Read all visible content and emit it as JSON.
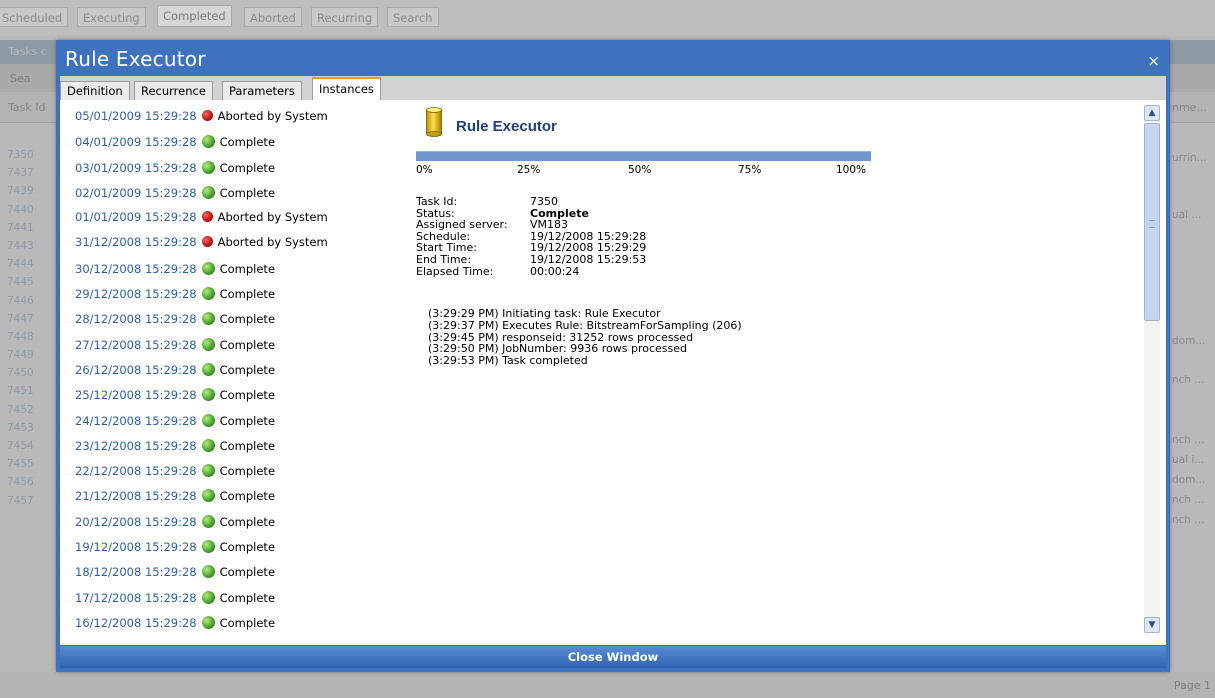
{
  "background": {
    "tabs": [
      "Scheduled",
      "Executing",
      "Completed",
      "Aborted",
      "Recurring",
      "Search"
    ],
    "active_tab": "Completed",
    "strip_label": "Tasks c",
    "search_label": "Sea",
    "column_header": "Task Id",
    "column_header_right": "nme...",
    "task_ids": [
      "7350",
      "7437",
      "7439",
      "7440",
      "7441",
      "7443",
      "7444",
      "7445",
      "7446",
      "7447",
      "7448",
      "7449",
      "7450",
      "7451",
      "7452",
      "7453",
      "7454",
      "7455",
      "7456",
      "7457"
    ],
    "right_fragments": [
      "urrin...",
      "ual ...",
      "dom...",
      "nch ...",
      "nch ...",
      "ual i...",
      "dom...",
      "nch ...",
      "nch ..."
    ],
    "page_label": "Page 1"
  },
  "modal": {
    "title": "Rule Executor",
    "close_label": "×",
    "tabs": [
      "Definition",
      "Recurrence",
      "Parameters",
      "Instances"
    ],
    "active_tab": "Instances",
    "footer_button": "Close Window"
  },
  "instances": [
    {
      "date": "05/01/2009 15:29:28",
      "status": "Aborted by System",
      "color": "red"
    },
    {
      "date": "04/01/2009 15:29:28",
      "status": "Complete",
      "color": "green"
    },
    {
      "date": "03/01/2009 15:29:28",
      "status": "Complete",
      "color": "green"
    },
    {
      "date": "02/01/2009 15:29:28",
      "status": "Complete",
      "color": "green"
    },
    {
      "date": "01/01/2009 15:29:28",
      "status": "Aborted by System",
      "color": "red"
    },
    {
      "date": "31/12/2008 15:29:28",
      "status": "Aborted by System",
      "color": "red"
    },
    {
      "date": "30/12/2008 15:29:28",
      "status": "Complete",
      "color": "green"
    },
    {
      "date": "29/12/2008 15:29:28",
      "status": "Complete",
      "color": "green"
    },
    {
      "date": "28/12/2008 15:29:28",
      "status": "Complete",
      "color": "green"
    },
    {
      "date": "27/12/2008 15:29:28",
      "status": "Complete",
      "color": "green"
    },
    {
      "date": "26/12/2008 15:29:28",
      "status": "Complete",
      "color": "green"
    },
    {
      "date": "25/12/2008 15:29:28",
      "status": "Complete",
      "color": "green"
    },
    {
      "date": "24/12/2008 15:29:28",
      "status": "Complete",
      "color": "green"
    },
    {
      "date": "23/12/2008 15:29:28",
      "status": "Complete",
      "color": "green"
    },
    {
      "date": "22/12/2008 15:29:28",
      "status": "Complete",
      "color": "green"
    },
    {
      "date": "21/12/2008 15:29:28",
      "status": "Complete",
      "color": "green"
    },
    {
      "date": "20/12/2008 15:29:28",
      "status": "Complete",
      "color": "green"
    },
    {
      "date": "19/12/2008 15:29:28",
      "status": "Complete",
      "color": "green"
    },
    {
      "date": "18/12/2008 15:29:28",
      "status": "Complete",
      "color": "green"
    },
    {
      "date": "17/12/2008 15:29:28",
      "status": "Complete",
      "color": "green"
    },
    {
      "date": "16/12/2008 15:29:28",
      "status": "Complete",
      "color": "green"
    }
  ],
  "detail": {
    "title": "Rule Executor",
    "icon": "database-icon",
    "progress_fraction": 1.0,
    "progress_ticks": [
      "0%",
      "25%",
      "50%",
      "75%",
      "100%"
    ],
    "fields": [
      {
        "label": "Task Id:",
        "value": "7350",
        "bold": false
      },
      {
        "label": "Status:",
        "value": "Complete",
        "bold": true
      },
      {
        "label": "Assigned server:",
        "value": "VM183",
        "bold": false
      },
      {
        "label": "Schedule:",
        "value": "19/12/2008 15:29:28",
        "bold": false
      },
      {
        "label": "Start Time:",
        "value": "19/12/2008 15:29:29",
        "bold": false
      },
      {
        "label": "End Time:",
        "value": "19/12/2008 15:29:53",
        "bold": false
      },
      {
        "label": "Elapsed Time:",
        "value": "00:00:24",
        "bold": false
      }
    ],
    "log": [
      "(3:29:29 PM) Initiating task: Rule Executor",
      "(3:29:37 PM) Executes Rule: BitstreamForSampling (206)",
      "(3:29:45 PM) responseid: 31252 rows processed",
      "(3:29:50 PM) JobNumber: 9936 rows processed",
      "(3:29:53 PM) Task completed"
    ]
  },
  "colors": {
    "modal_header": "#3e72bf",
    "link": "#2d5ea9",
    "tab_accent": "#f29a1e",
    "progress": "#6f97cc",
    "status_red": "#c41212",
    "status_green": "#3f9d28"
  }
}
